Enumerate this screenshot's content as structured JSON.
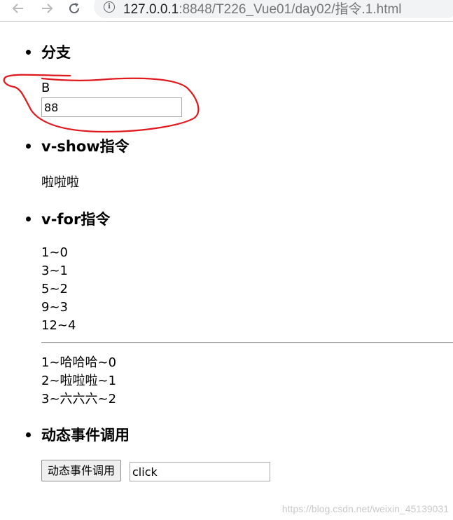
{
  "browser": {
    "url_host": "127.0.0.1",
    "url_path": ":8848/T226_Vue01/day02/指令.1.html"
  },
  "sections": {
    "branch": {
      "heading": "分支",
      "value_text": "B",
      "input_value": "88"
    },
    "vshow": {
      "heading": "v-show指令",
      "text": "啦啦啦"
    },
    "vfor": {
      "heading": "v-for指令",
      "list1": [
        "1~0",
        "3~1",
        "5~2",
        "9~3",
        "12~4"
      ],
      "list2": [
        "1~哈哈哈~0",
        "2~啦啦啦~1",
        "3~六六六~2"
      ]
    },
    "event": {
      "heading": "动态事件调用",
      "button_label": "动态事件调用",
      "input_value": "click"
    }
  },
  "watermark": "https://blog.csdn.net/weixin_45139031",
  "colors": {
    "annotation": "#e0191e"
  },
  "icons": {
    "back": "back-arrow-icon",
    "forward": "forward-arrow-icon",
    "reload": "reload-icon",
    "info": "info-icon"
  }
}
